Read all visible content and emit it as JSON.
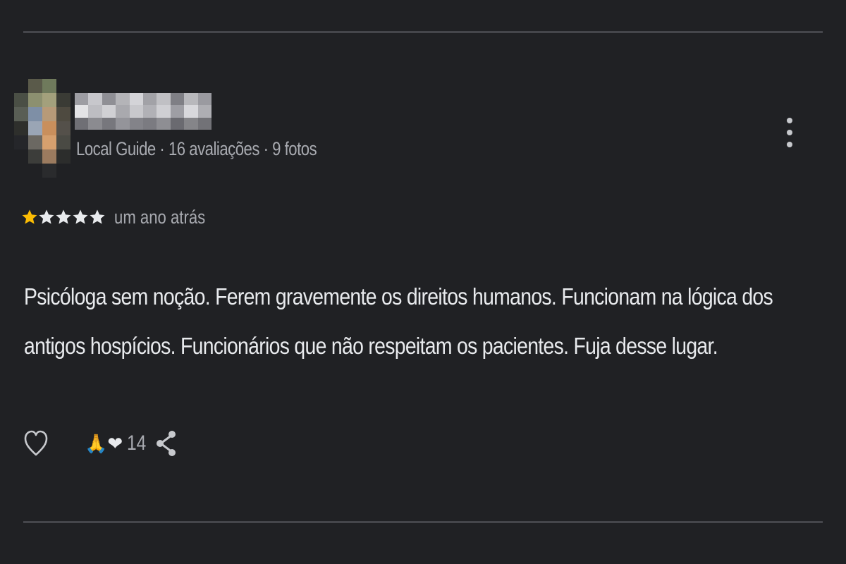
{
  "reviewer": {
    "avatar_alt": "pixelated profile photo",
    "name_hidden": "",
    "meta": "Local Guide · 16 avaliações · 9 fotos"
  },
  "rating": {
    "stars_filled": 1,
    "stars_total": 5,
    "filled_color": "#fbbc04",
    "empty_color": "#e8eaed",
    "time": "um ano atrás"
  },
  "review": {
    "text": "Psicóloga sem noção. Ferem gravemente os direitos humanos. Funcionam na lógica dos antigos hospícios. Funcionários que não respeitam os pacientes. Fuja desse lugar."
  },
  "actions": {
    "like_icon": "heart-outline-icon",
    "reaction_emojis": "🙏❤",
    "reaction_count": "14",
    "share_icon": "share-icon",
    "more_icon": "more-vertical-icon"
  },
  "colors": {
    "background": "#202124",
    "divider": "#45464b",
    "secondary_text": "#a8aab0"
  }
}
